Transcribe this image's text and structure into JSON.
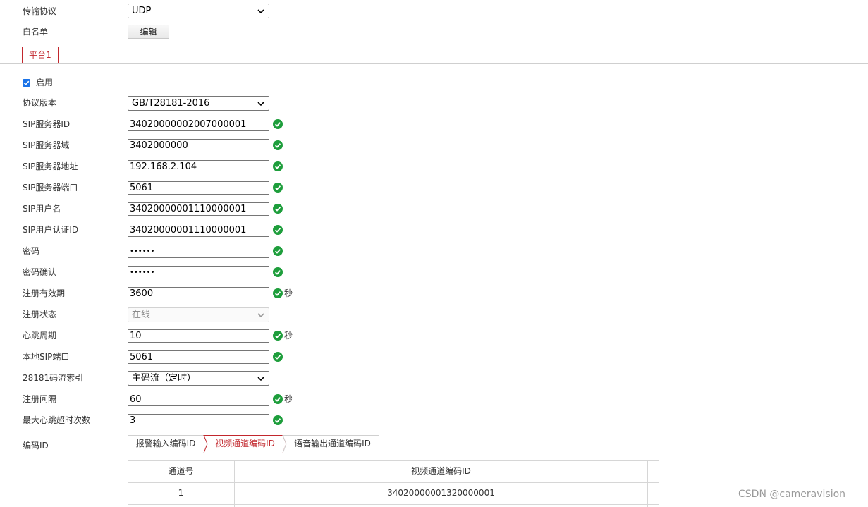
{
  "transport": {
    "label": "传输协议",
    "value": "UDP"
  },
  "whitelist": {
    "label": "白名单",
    "button": "编辑"
  },
  "platform_tab": "平台1",
  "enable": {
    "label": "启用",
    "checked": true
  },
  "fields": [
    {
      "label": "协议版本",
      "type": "select",
      "value": "GB/T28181-2016"
    },
    {
      "label": "SIP服务器ID",
      "type": "input",
      "value": "34020000002007000001",
      "ok": true
    },
    {
      "label": "SIP服务器域",
      "type": "input",
      "value": "3402000000",
      "ok": true
    },
    {
      "label": "SIP服务器地址",
      "type": "input",
      "value": "192.168.2.104",
      "ok": true
    },
    {
      "label": "SIP服务器端口",
      "type": "input",
      "value": "5061",
      "ok": true
    },
    {
      "label": "SIP用户名",
      "type": "input",
      "value": "34020000001110000001",
      "ok": true
    },
    {
      "label": "SIP用户认证ID",
      "type": "input",
      "value": "34020000001110000001",
      "ok": true
    },
    {
      "label": "密码",
      "type": "password",
      "value": "••••••",
      "ok": true
    },
    {
      "label": "密码确认",
      "type": "password",
      "value": "••••••",
      "ok": true
    },
    {
      "label": "注册有效期",
      "type": "input",
      "value": "3600",
      "ok": true,
      "unit": "秒"
    },
    {
      "label": "注册状态",
      "type": "select-disabled",
      "value": "在线"
    },
    {
      "label": "心跳周期",
      "type": "input",
      "value": "10",
      "ok": true,
      "unit": "秒"
    },
    {
      "label": "本地SIP端口",
      "type": "input",
      "value": "5061",
      "ok": true
    },
    {
      "label": "28181码流索引",
      "type": "select",
      "value": "主码流（定时）"
    },
    {
      "label": "注册间隔",
      "type": "input",
      "value": "60",
      "ok": true,
      "unit": "秒"
    },
    {
      "label": "最大心跳超时次数",
      "type": "input",
      "value": "3",
      "ok": true
    }
  ],
  "code_id": {
    "label": "编码ID",
    "tabs": [
      "报警输入编码ID",
      "视频通道编码ID",
      "语音输出通道编码ID"
    ],
    "active_tab": 1,
    "table": {
      "headers": [
        "通道号",
        "视频通道编码ID"
      ],
      "rows": [
        [
          "1",
          "34020000001320000001"
        ]
      ]
    }
  },
  "watermark": "CSDN @cameravision",
  "colors": {
    "accent": "#c2272d",
    "ok_green": "#1e9e3c",
    "checkbox": "#1a73e8"
  }
}
